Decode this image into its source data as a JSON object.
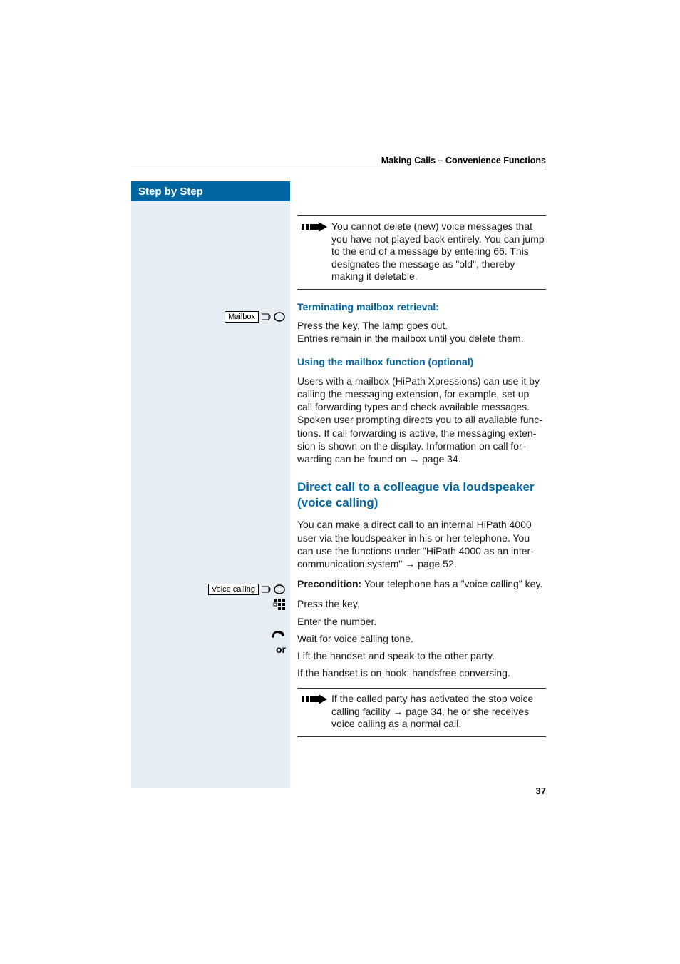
{
  "header": {
    "breadcrumb": "Making Calls – Convenience Functions"
  },
  "sidebar": {
    "title": "Step by Step"
  },
  "keys": {
    "mailbox": "Mailbox",
    "voice_calling": "Voice calling",
    "or": "or"
  },
  "notes": {
    "note1": "You cannot delete (new) voice messages that you have not played back entirely. You can jump to the end of a message by entering 66. This designa­tes the message as \"old\", thereby making it dele­table.",
    "note2_pre": "If the called party has activated the stop voice calling facility ",
    "note2_link": "→ page 34",
    "note2_post": ", he or she receives voice calling as a normal call."
  },
  "headings": {
    "term_mailbox": "Terminating mailbox retrieval:",
    "using_mailbox": "Using the mailbox function (optional)",
    "direct_call": "Direct call to a colleague via loudspeaker (voice calling)"
  },
  "body": {
    "press_key_lamp": "Press the key. The lamp goes out.",
    "entries_remain": "Entries remain in the mailbox until you delete them.",
    "users_mailbox": "Users with a mailbox (HiPath Xpressions) can use it by calling the messaging extension, for example, set up call forwarding types and check available messages. Spoken user prompting directs you to all available func­tions. If call forwarding is active, the messaging exten­sion is shown on the display. Information on call for­warding can be found on ",
    "users_mailbox_link": "→ page 34.",
    "direct_call_intro": "You can make a direct call to an internal HiPath 4000 user via the loudspeaker in his or her telephone. You can use the functions under \"HiPath 4000 as an inter­communication system\" ",
    "direct_call_link": "→ page 52.",
    "precondition_label": "Precondition:",
    "precondition_text": " Your telephone has a \"voice calling\" key.",
    "press_key": "Press the key.",
    "enter_number": "Enter the number.",
    "wait_tone": "Wait for voice calling tone.",
    "lift_handset": "Lift the handset and speak to the other party.",
    "handsfree": "If the handset is on-hook: handsfree conversing."
  },
  "page_number": "37"
}
